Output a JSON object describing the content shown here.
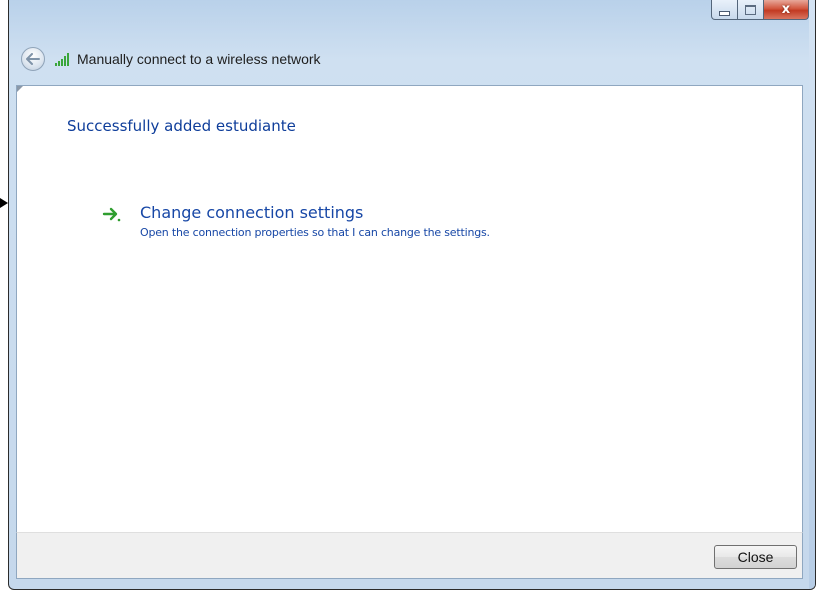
{
  "window": {
    "title": "Manually connect to a wireless network",
    "caption": {
      "minimize": "minimize",
      "maximize": "maximize",
      "close": "x"
    }
  },
  "icons": {
    "back": "back-arrow-icon",
    "wireless": "wireless-signal-icon",
    "link_arrow": "green-arrow-icon"
  },
  "content": {
    "heading": "Successfully added estudiante",
    "link": {
      "title": "Change connection settings",
      "description": "Open the connection properties so that I can change the settings."
    }
  },
  "footer": {
    "close_label": "Close"
  },
  "colors": {
    "heading": "#0e3d9a",
    "link": "#1747a6",
    "arrow": "#2f9e2f",
    "frame": "#b9d1ea",
    "close_button": "#c23a22"
  }
}
